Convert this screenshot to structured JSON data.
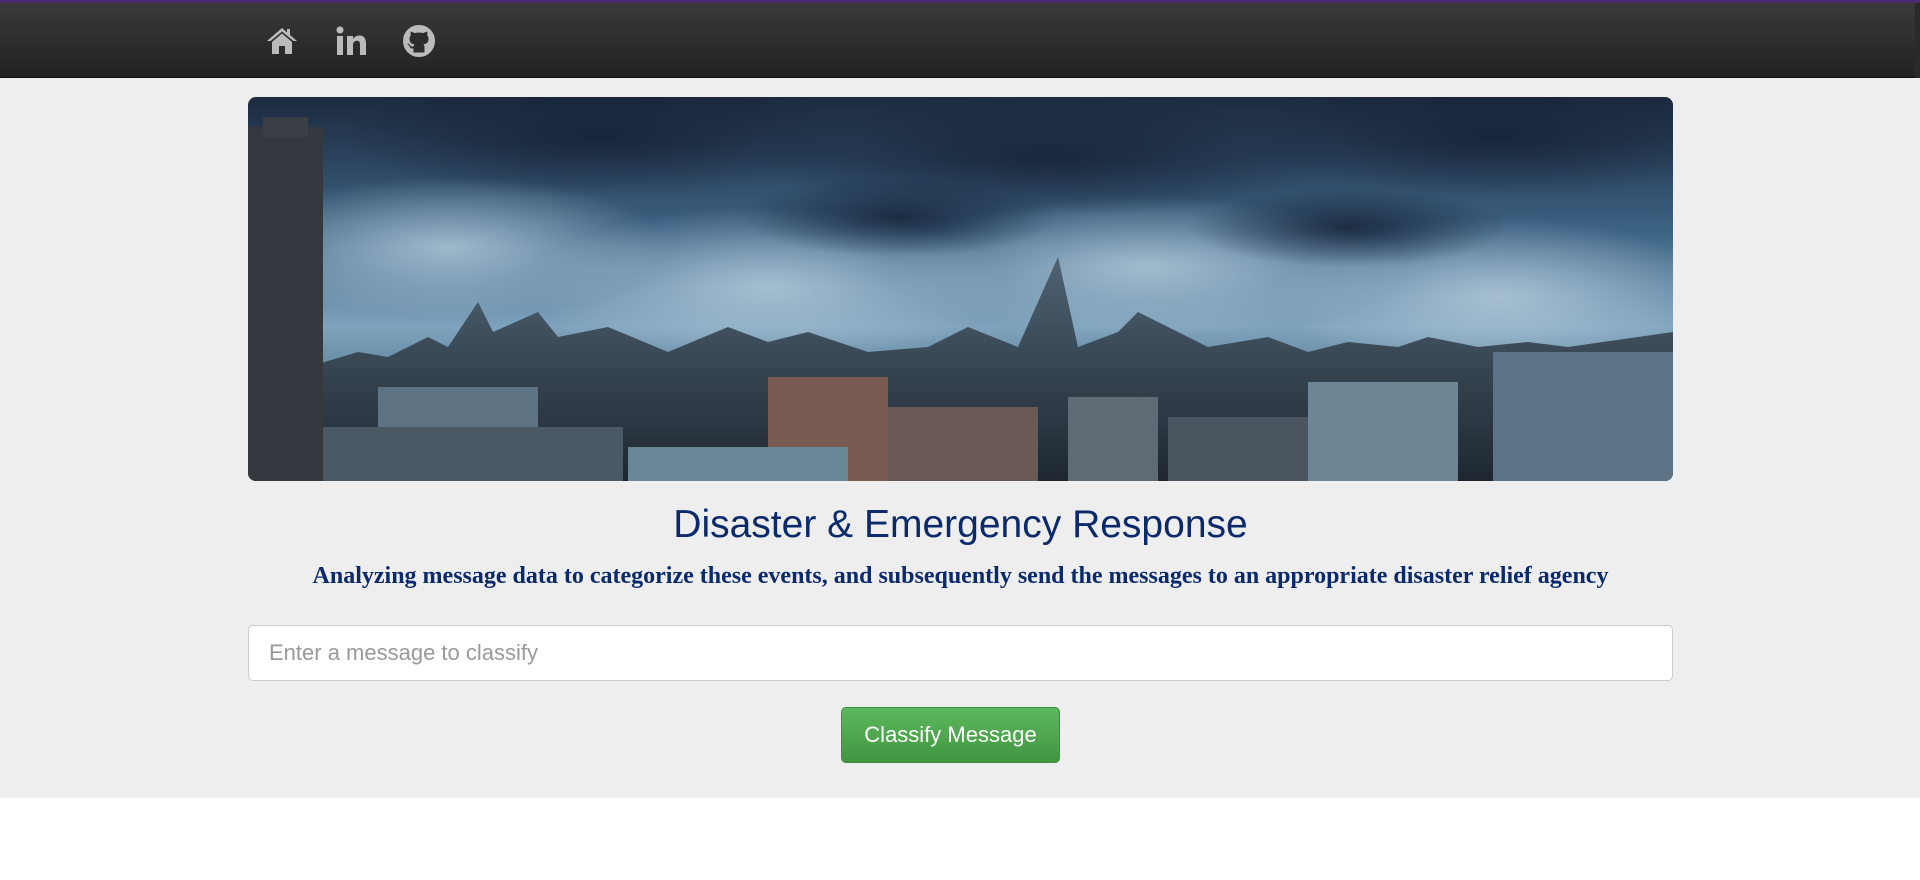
{
  "navbar": {
    "icons": [
      {
        "name": "home-icon"
      },
      {
        "name": "linkedin-icon"
      },
      {
        "name": "github-icon"
      }
    ],
    "icon_color": "#bbbbbb"
  },
  "header": {
    "title": "Disaster & Emergency Response",
    "subtitle": "Analyzing message data to categorize these events, and subsequently send the messages to an appropriate disaster relief agency"
  },
  "form": {
    "message_placeholder": "Enter a message to classify",
    "message_value": "",
    "submit_label": "Classify Message"
  },
  "colors": {
    "title": "#0b2a6b",
    "button": "#5cb85c",
    "background": "#eeeeee"
  }
}
